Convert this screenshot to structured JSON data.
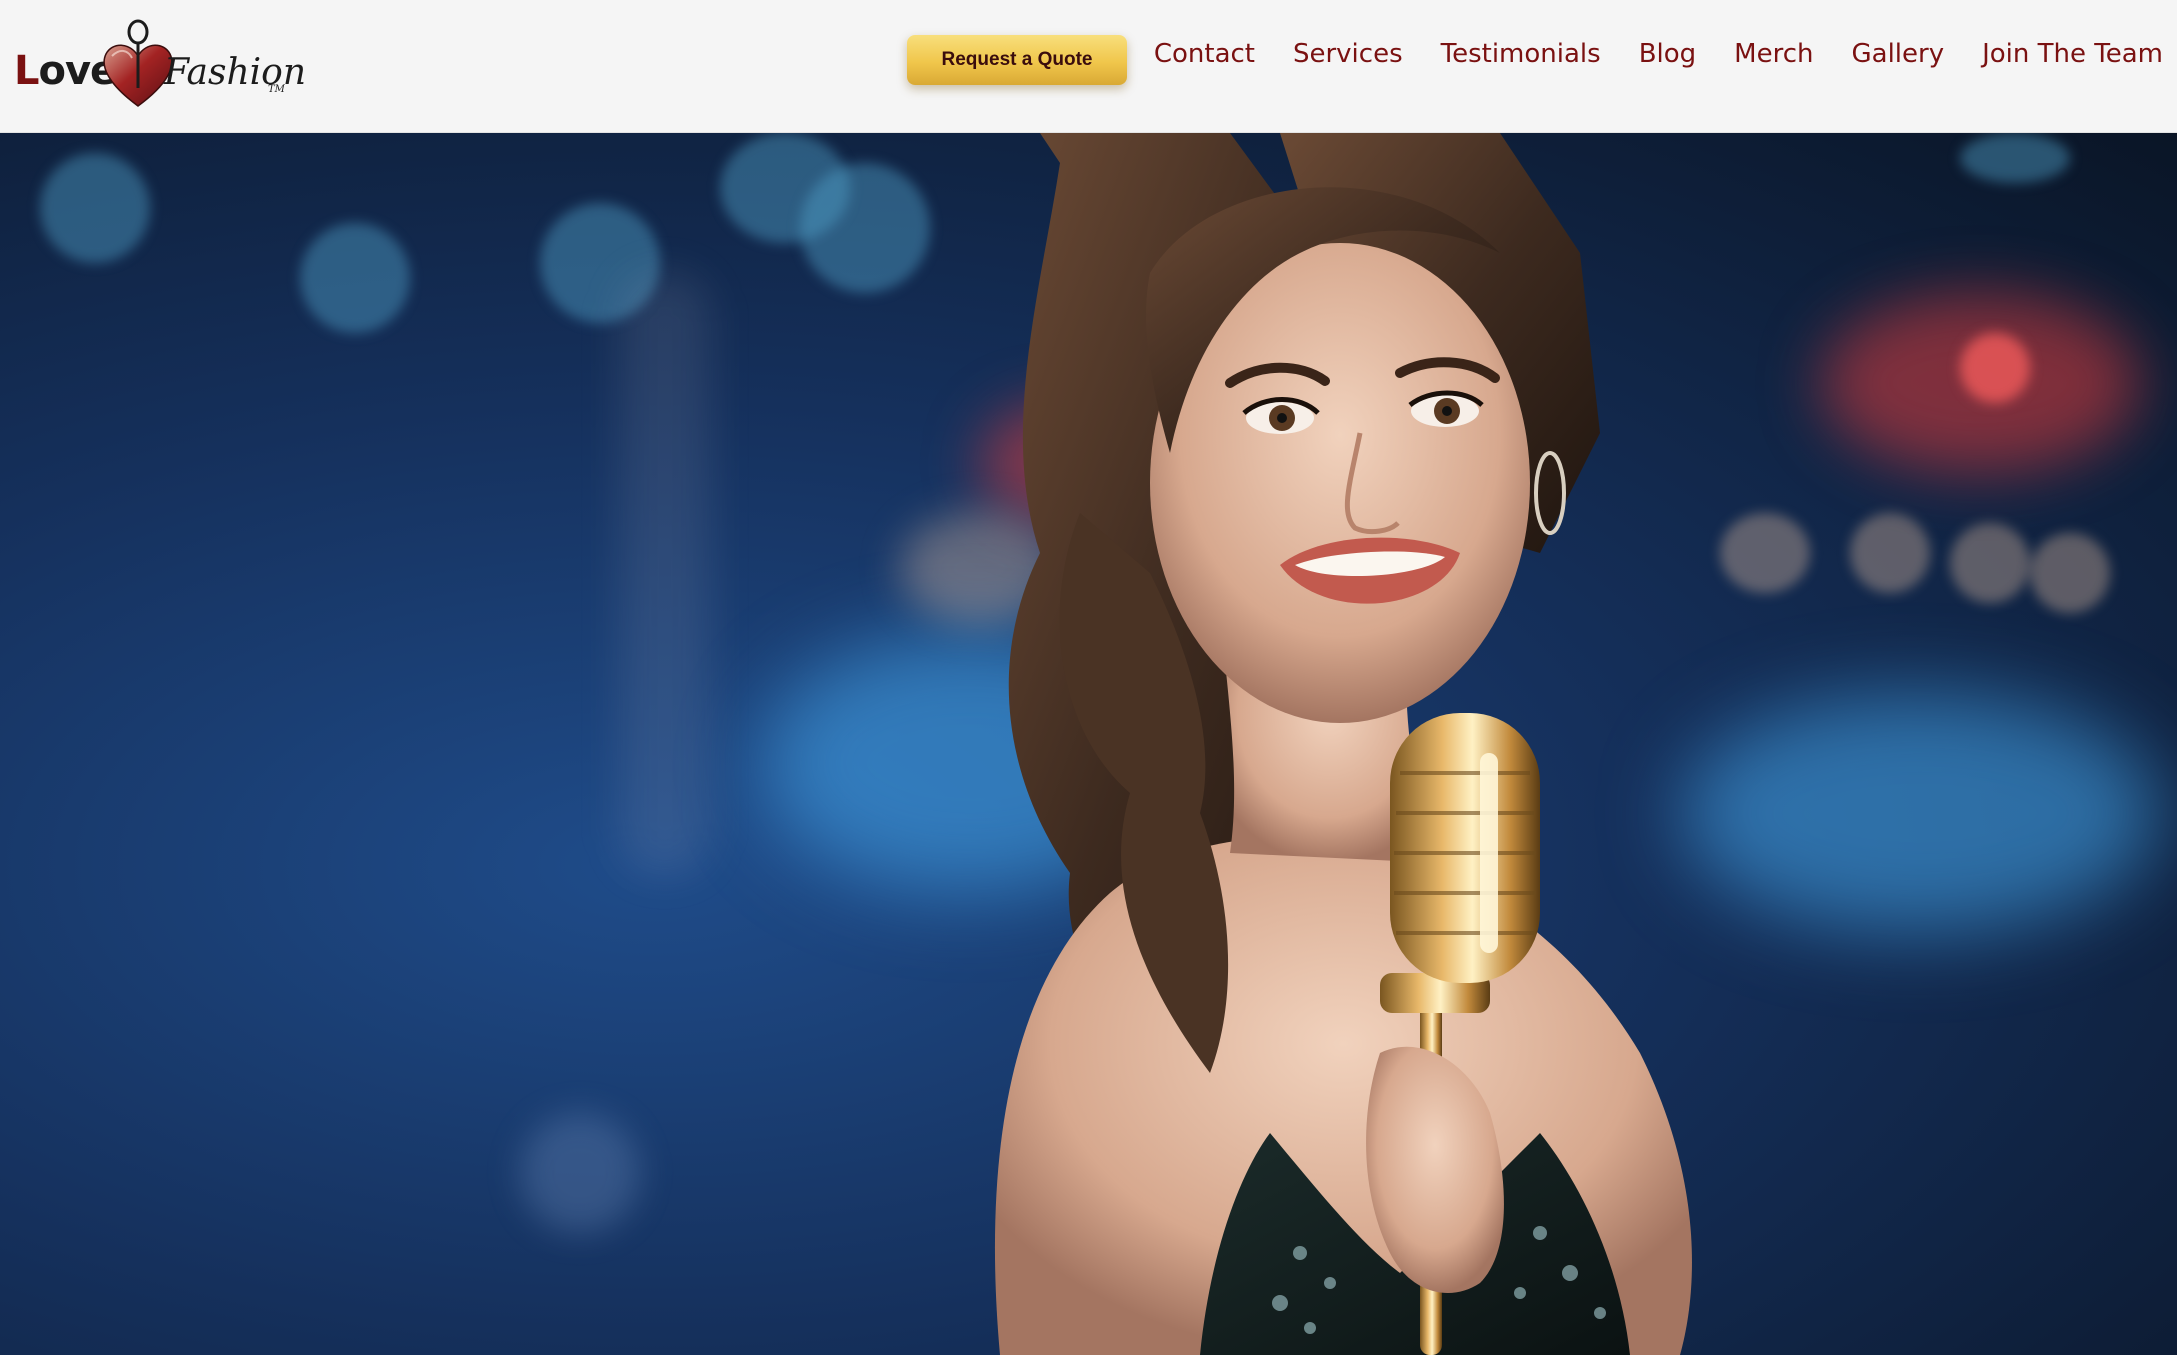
{
  "brand": {
    "logo_word1": "Love",
    "logo_word2": "Fashion",
    "logo_tm": "TM"
  },
  "header": {
    "quote_button": "Request a Quote",
    "nav": [
      {
        "label": "Contact"
      },
      {
        "label": "Services"
      },
      {
        "label": "Testimonials"
      },
      {
        "label": "Blog"
      },
      {
        "label": "Merch"
      },
      {
        "label": "Gallery"
      },
      {
        "label": "Join The Team"
      }
    ]
  },
  "colors": {
    "accent_maroon": "#7a1111",
    "button_gold": "#f0c64b",
    "header_bg": "#f5f5f5"
  },
  "hero": {
    "subject": "singer-with-vintage-microphone"
  }
}
